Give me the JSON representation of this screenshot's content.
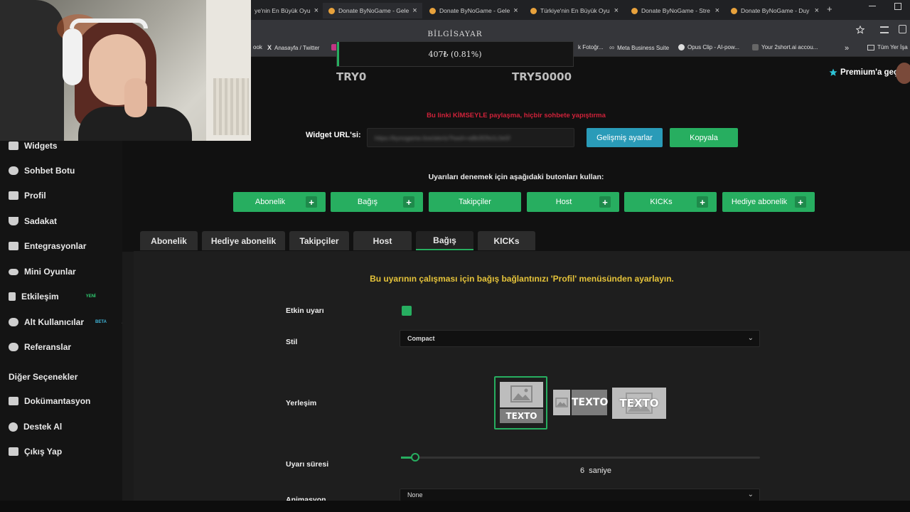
{
  "browser": {
    "tabs": [
      {
        "label": "ye'nin En Büyük Oyu"
      },
      {
        "label": "Donate ByNoGame - Gele"
      },
      {
        "label": "Donate ByNoGame - Gele"
      },
      {
        "label": "Türkiye'nin En Büyük Oyu"
      },
      {
        "label": "Donate ByNoGame - Stre"
      },
      {
        "label": "Donate ByNoGame - Duy"
      }
    ],
    "new_tab": "+",
    "bookmarks": [
      {
        "label": "ook"
      },
      {
        "label": "Anasayfa / Twitter"
      },
      {
        "label": "k Fotoğr..."
      },
      {
        "label": "Meta Business Suite"
      },
      {
        "label": "Opus Clip - AI-pow..."
      },
      {
        "label": "Your 2short.ai accou..."
      },
      {
        "label": "Tüm Yer İşa"
      }
    ]
  },
  "overlay": {
    "title": "BİLGİSAYAR",
    "progress_text": "407₺ (0.81%)",
    "progress_fraction": 0.0081,
    "min_label": "TRY0",
    "max_label": "TRY50000"
  },
  "header": {
    "premium": "Premium'a geç"
  },
  "sidebar": {
    "items": [
      {
        "label": "Widgets"
      },
      {
        "label": "Sohbet Botu"
      },
      {
        "label": "Profil"
      },
      {
        "label": "Sadakat"
      },
      {
        "label": "Entegrasyonlar"
      },
      {
        "label": "Mini Oyunlar"
      },
      {
        "label": "Etkileşim",
        "badge": "YENİ"
      },
      {
        "label": "Alt Kullanıcılar",
        "badge": "BETA"
      },
      {
        "label": "Referanslar"
      }
    ],
    "section_title": "Diğer Seçenekler",
    "other_items": [
      {
        "label": "Dokümantasyon"
      },
      {
        "label": "Destek Al"
      },
      {
        "label": "Çıkış Yap"
      }
    ]
  },
  "widget": {
    "warning": "Bu linki KİMSEYLE paylaşma, hiçbir sohbete yapıştırma",
    "url_label": "Widget URL'si:",
    "url_value": "https://bynogame.live/alerts?hash=a8b3f2fe1L0e5f",
    "advanced_button": "Gelişmiş ayarlar",
    "copy_button": "Kopyala",
    "test_hint": "Uyarıları denemek için aşağıdaki butonları kullan:",
    "test_buttons": [
      {
        "label": "Abonelik"
      },
      {
        "label": "Bağış"
      },
      {
        "label": "Takipçiler"
      },
      {
        "label": "Host"
      },
      {
        "label": "KICKs"
      },
      {
        "label": "Hediye abonelik"
      }
    ]
  },
  "tabs": [
    {
      "label": "Abonelik"
    },
    {
      "label": "Hediye abonelik"
    },
    {
      "label": "Takipçiler"
    },
    {
      "label": "Host"
    },
    {
      "label": "Bağış",
      "active": true
    },
    {
      "label": "KICKs"
    }
  ],
  "settings": {
    "notice": "Bu uyarının çalışması için bağış bağlantınızı 'Profil' menüsünden ayarlayın.",
    "enabled_label": "Etkin uyarı",
    "enabled": true,
    "style_label": "Stil",
    "style_value": "Compact",
    "layout_label": "Yerleşim",
    "layout_options": [
      {
        "text": "TEXTO",
        "selected": true
      },
      {
        "text": "TEXTO"
      },
      {
        "text": "TEXTO"
      }
    ],
    "duration_label": "Uyarı süresi",
    "duration_value": "6",
    "duration_unit": "saniye",
    "duration_fraction": 0.04,
    "animation_label": "Animasyon",
    "animation_value": "None"
  },
  "colors": {
    "accent_green": "#27ae60",
    "info_blue": "#2a9bb8",
    "warning_red": "#d0223a",
    "notice_yellow": "#e5c33a"
  }
}
